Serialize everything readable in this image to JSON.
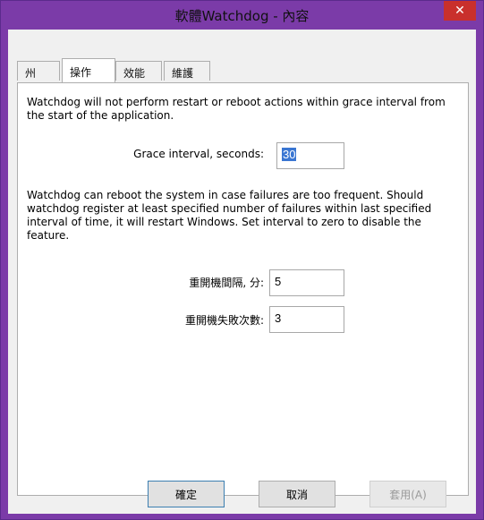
{
  "window": {
    "title": "軟體Watchdog - 內容",
    "close_label": "✕"
  },
  "tabs": [
    {
      "label": "州"
    },
    {
      "label": "操作"
    },
    {
      "label": "效能"
    },
    {
      "label": "維護"
    }
  ],
  "active_tab": 1,
  "panel": {
    "grace_text": "Watchdog will not perform restart or reboot actions within grace interval from the start of the application.",
    "grace_label": "Grace interval, seconds:",
    "grace_value": "30",
    "reboot_text": "Watchdog can reboot the system in case failures are too frequent. Should watchdog register at least specified number of failures within last specified interval of time, it will restart Windows. Set interval to zero to disable the feature.",
    "reboot_interval_label": "重開機間隔, 分:",
    "reboot_interval_value": "5",
    "reboot_count_label": "重開機失敗次數:",
    "reboot_count_value": "3"
  },
  "buttons": {
    "ok": "確定",
    "cancel": "取消",
    "apply": "套用(A)"
  },
  "colors": {
    "frame": "#7b3ba8",
    "close": "#c9302c",
    "selection": "#3a76d2"
  }
}
